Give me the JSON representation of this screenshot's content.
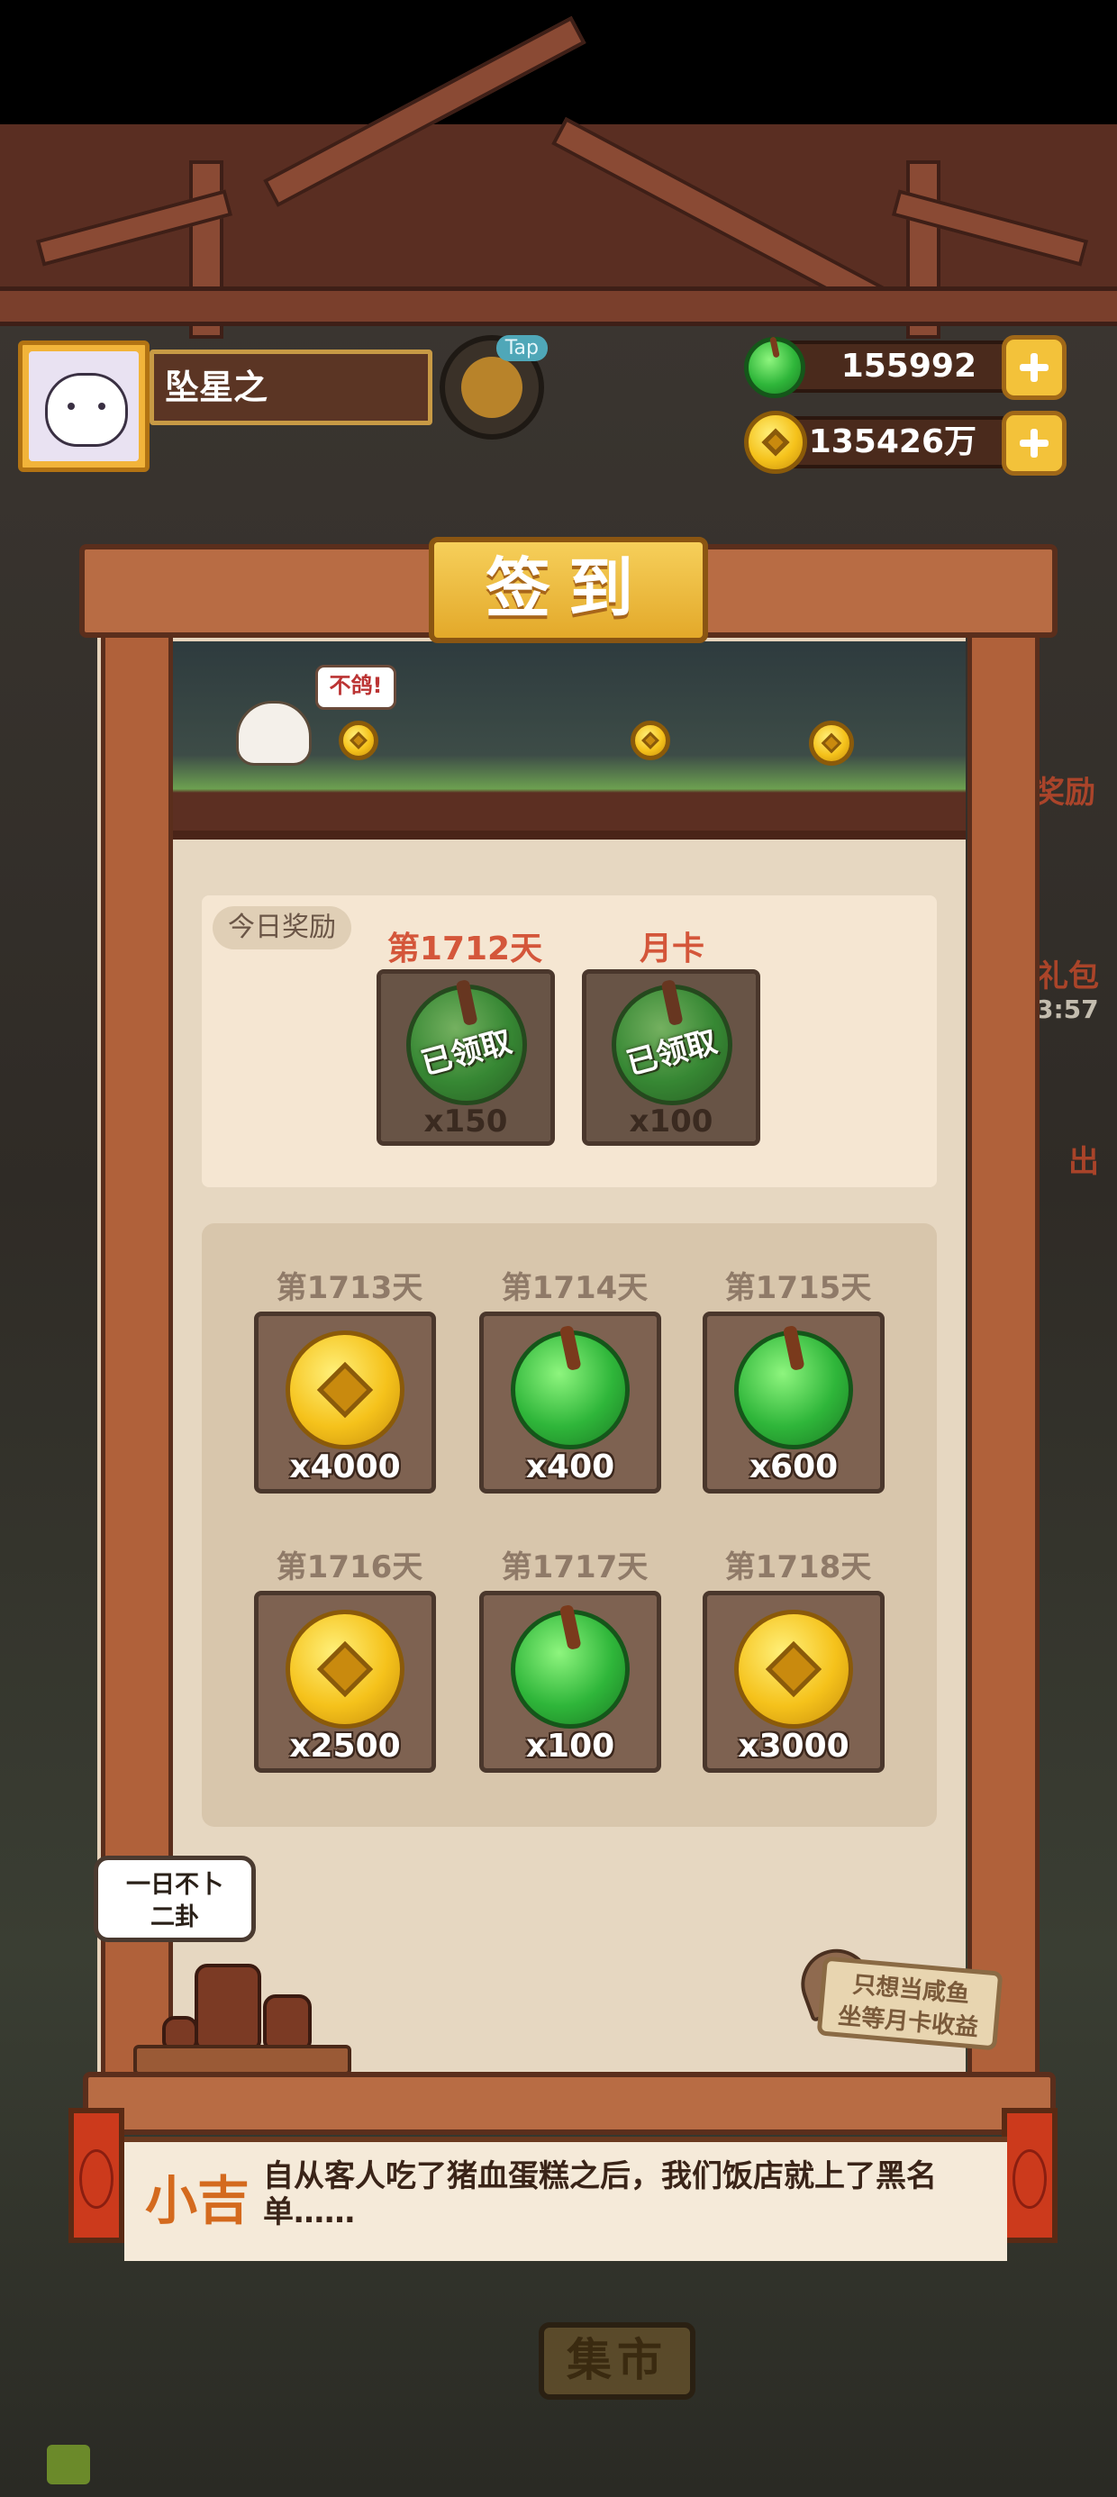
{
  "player": {
    "name": "坠星之",
    "tap_label": "Tap"
  },
  "currency": {
    "jade_amount": "155992",
    "coin_amount": "135426万"
  },
  "signin": {
    "title": "签到",
    "banner_bubble": "不鸽!",
    "today": {
      "tag": "今日奖励",
      "rewards": [
        {
          "day": "第1712天",
          "status": "已领取",
          "qty": "x150",
          "icon": "jade-icon"
        },
        {
          "day": "月卡",
          "status": "已领取",
          "qty": "x100",
          "icon": "jade-icon"
        }
      ]
    },
    "upcoming": [
      {
        "day": "第1713天",
        "qty": "x4000",
        "icon": "coin-icon"
      },
      {
        "day": "第1714天",
        "qty": "x400",
        "icon": "jade-icon"
      },
      {
        "day": "第1715天",
        "qty": "x600",
        "icon": "jade-icon"
      },
      {
        "day": "第1716天",
        "qty": "x2500",
        "icon": "coin-icon"
      },
      {
        "day": "第1717天",
        "qty": "x100",
        "icon": "jade-icon"
      },
      {
        "day": "第1718天",
        "qty": "x3000",
        "icon": "coin-icon"
      }
    ]
  },
  "props": {
    "divine_bubble_line1": "一日不卜",
    "divine_bubble_line2": "二卦",
    "sign_line1": "只想当咸鱼",
    "sign_line2": "坐等月卡收益"
  },
  "dialog": {
    "speaker": "小吉",
    "text": "自从客人吃了猪血蛋糕之后，我们饭店就上了黑名单……"
  },
  "bottom_nav": {
    "market_label": "集市"
  },
  "side_buttons": {
    "label_a": "奖励",
    "label_b": "礼包",
    "label_c": "3:57",
    "label_d": "出"
  },
  "colors": {
    "accent_red": "#d4563a",
    "gold": "#f3c23a",
    "jade": "#2fb63a"
  }
}
